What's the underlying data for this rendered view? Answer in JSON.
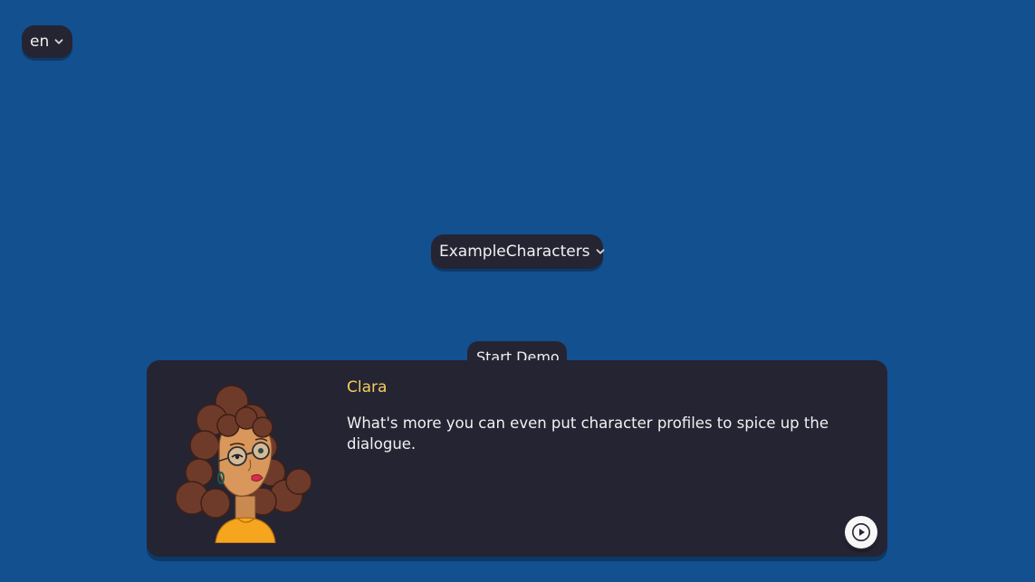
{
  "language_select": {
    "value": "en",
    "icon": "chevron-down-icon"
  },
  "character_set_select": {
    "value": "ExampleCharacters",
    "icon": "chevron-down-icon"
  },
  "start_button": {
    "label": "Start Demo"
  },
  "dialogue": {
    "speaker": "Clara",
    "text": "What's more you can even put character profiles to spice up the dialogue.",
    "portrait": "clara-portrait",
    "next_icon": "play-icon"
  },
  "colors": {
    "background": "#13508f",
    "panel": "#252433",
    "speaker_name": "#f2cf5b",
    "text": "#f1f1f1"
  }
}
